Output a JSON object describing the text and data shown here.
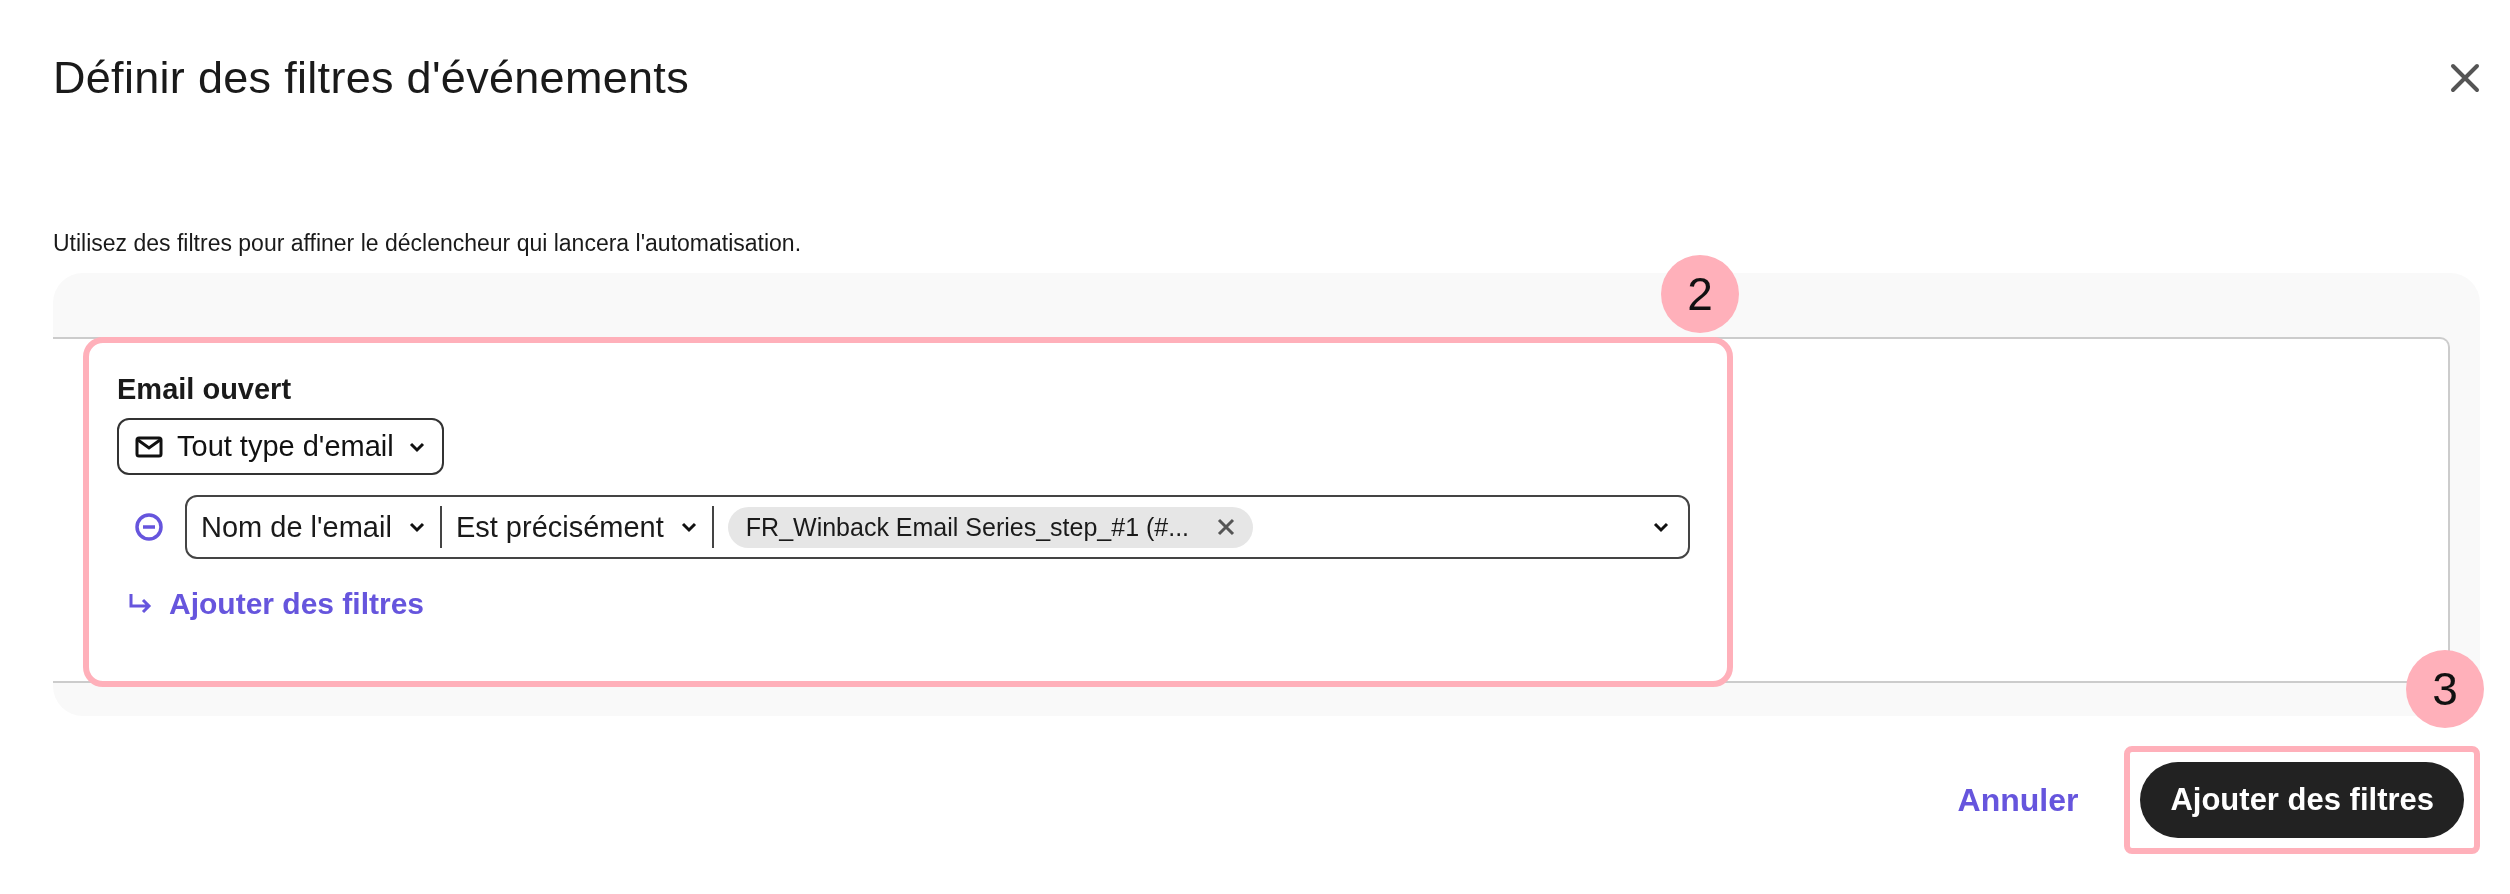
{
  "dialog": {
    "title": "Définir des filtres d'événements",
    "description": "Utilisez des filtres pour affiner le déclencheur qui lancera l'automatisation."
  },
  "trigger": {
    "label": "Email ouvert",
    "email_type": "Tout type d'email",
    "filters": [
      {
        "field": "Nom de l'email",
        "operator": "Est précisément",
        "values": [
          "FR_Winback Email Series_step_#1 (#..."
        ]
      }
    ],
    "add_filter": "Ajouter des filtres"
  },
  "annotations": [
    {
      "number": "2"
    },
    {
      "number": "3"
    }
  ],
  "footer": {
    "cancel": "Annuler",
    "confirm": "Ajouter des filtres"
  }
}
